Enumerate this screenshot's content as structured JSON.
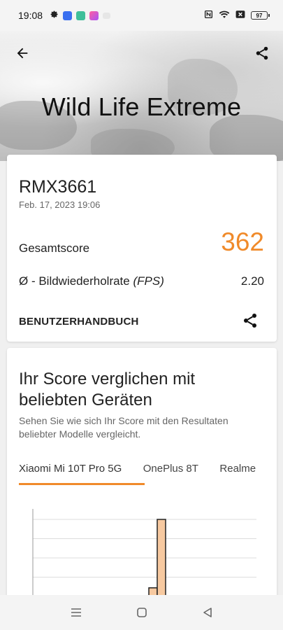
{
  "status_bar": {
    "time": "19:08",
    "battery": "97",
    "icons": [
      "settings-icon",
      "app-icon-blue",
      "app-icon-green",
      "app-icon-pink",
      "app-icon-small",
      "nfc-icon",
      "wifi-icon",
      "signal-off-icon",
      "battery-icon"
    ]
  },
  "hero": {
    "title": "Wild Life Extreme",
    "back_icon": "arrow-left-icon",
    "share_icon": "share-icon"
  },
  "result": {
    "device_name": "RMX3661",
    "date": "Feb. 17, 2023 19:06",
    "score_label": "Gesamtscore",
    "score_value": "362",
    "fps_label_prefix": "Ø - Bildwiederholrate ",
    "fps_label_unit": "(FPS)",
    "fps_value": "2.20",
    "manual_label": "BENUTZERHANDBUCH"
  },
  "comparison": {
    "title": "Ihr Score verglichen mit beliebten Geräten",
    "subtitle": "Sehen Sie wie sich Ihr Score mit den Resultaten beliebter Modelle vergleicht.",
    "tabs": [
      {
        "label": "Xiaomi Mi 10T Pro 5G",
        "active": true
      },
      {
        "label": "OnePlus 8T",
        "active": false
      },
      {
        "label": "Realme",
        "active": false
      }
    ]
  },
  "chart_data": {
    "type": "bar",
    "categories": [
      "",
      ""
    ],
    "values": [
      0.15,
      1.0
    ],
    "note_scale": "relative heights only, axis not labeled",
    "grid": true
  },
  "colors": {
    "accent": "#f08a2a",
    "bar_fill": "#f7c9a0",
    "bar_stroke": "#222222"
  },
  "nav_bar": {
    "icons": [
      "menu-icon",
      "home-square-icon",
      "back-triangle-icon"
    ]
  }
}
